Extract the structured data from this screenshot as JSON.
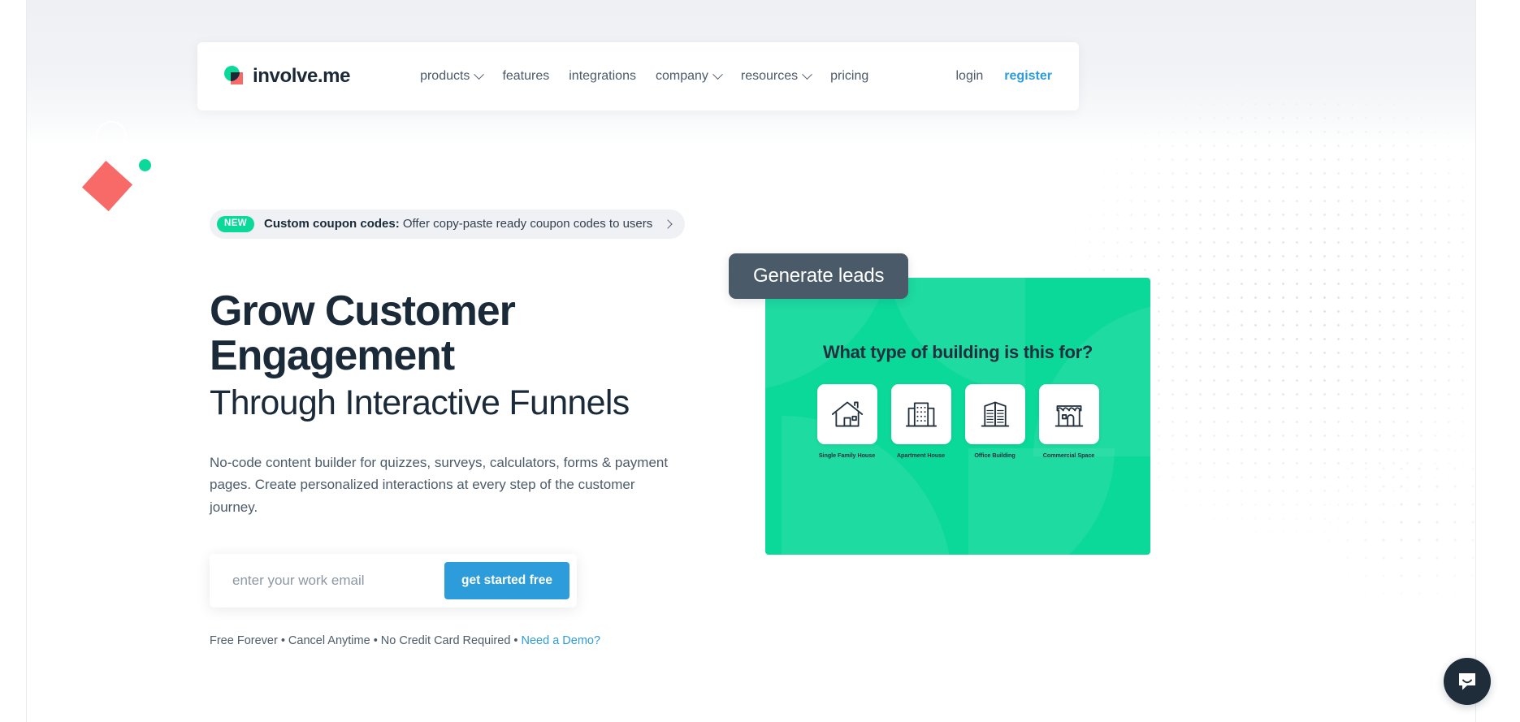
{
  "navbar": {
    "brand": {
      "name": "involve.me",
      "logo_icon": "involveme-logo-icon"
    },
    "links": [
      {
        "label": "products",
        "has_dropdown": true
      },
      {
        "label": "features",
        "has_dropdown": false
      },
      {
        "label": "integrations",
        "has_dropdown": false
      },
      {
        "label": "company",
        "has_dropdown": true
      },
      {
        "label": "resources",
        "has_dropdown": true
      },
      {
        "label": "pricing",
        "has_dropdown": false
      }
    ],
    "login_label": "login",
    "register_label": "register"
  },
  "announcement": {
    "badge": "NEW",
    "bold_text": "Custom coupon codes:",
    "text": " Offer copy-paste ready coupon codes to users",
    "arrow_icon": "chevron-right-icon"
  },
  "hero": {
    "headline": "Grow Customer Engagement",
    "subheadline": "Through Interactive Funnels",
    "blurb": "No-code content builder for quizzes, surveys, calculators, forms & payment pages. Create personalized interactions at every step of the customer journey."
  },
  "signup": {
    "email_placeholder": "enter your work email",
    "email_value": "",
    "cta_label": "get started free"
  },
  "trust": {
    "text": "Free Forever • Cancel Anytime • No Credit Card Required • ",
    "demo_link": "Need a Demo?"
  },
  "preview": {
    "tooltip_label": "Generate leads",
    "question": "What type of building is this for?",
    "options": [
      {
        "label": "Single Family House",
        "icon": "house-icon"
      },
      {
        "label": "Apartment House",
        "icon": "apartment-building-icon"
      },
      {
        "label": "Office Building",
        "icon": "office-building-icon"
      },
      {
        "label": "Commercial Space",
        "icon": "storefront-icon"
      }
    ]
  },
  "chat": {
    "icon": "chat-bubble-smile-icon"
  },
  "colors": {
    "brand_green": "#0bd99a",
    "brand_coral": "#f86a68",
    "accent_blue": "#2d9cdb",
    "dark_slate": "#1b2a38",
    "tooltip_slate": "#4a5a68"
  }
}
